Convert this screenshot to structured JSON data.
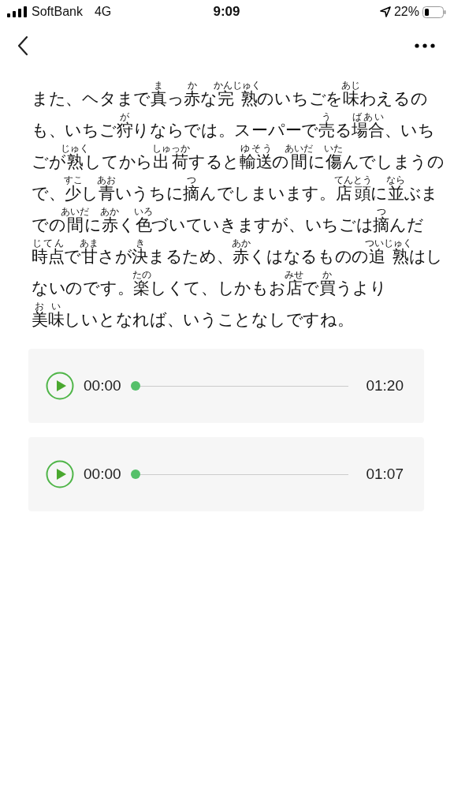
{
  "status_bar": {
    "carrier": "SoftBank",
    "network": "4G",
    "time": "9:09",
    "battery_percent": "22%"
  },
  "article": {
    "lines": [
      [
        {
          "text": "また、ヘタまで"
        },
        {
          "text": "真",
          "ruby": "ま"
        },
        {
          "text": "っ"
        },
        {
          "text": "赤",
          "ruby": "か"
        },
        {
          "text": "な"
        },
        {
          "text": "完熟",
          "ruby": "かんじゅく"
        },
        {
          "text": "のいちごを"
        },
        {
          "text": "味",
          "ruby": "あじ"
        },
        {
          "text": "わえるの"
        }
      ],
      [
        {
          "text": "も、いちご"
        },
        {
          "text": "狩",
          "ruby": "が"
        },
        {
          "text": "りならでは。スーパーで"
        },
        {
          "text": "売",
          "ruby": "う"
        },
        {
          "text": "る"
        },
        {
          "text": "場合",
          "ruby": "ばあい"
        },
        {
          "text": "、いち"
        }
      ],
      [
        {
          "text": "ごが"
        },
        {
          "text": "熟",
          "ruby": "じゅく"
        },
        {
          "text": "してから"
        },
        {
          "text": "出荷",
          "ruby": "しゅっか"
        },
        {
          "text": "すると"
        },
        {
          "text": "輸送",
          "ruby": "ゆそう"
        },
        {
          "text": "の"
        },
        {
          "text": "間",
          "ruby": "あいだ"
        },
        {
          "text": "に"
        },
        {
          "text": "傷",
          "ruby": "いた"
        },
        {
          "text": "んでしまうの"
        }
      ],
      [
        {
          "text": "で、"
        },
        {
          "text": "少",
          "ruby": "すこ"
        },
        {
          "text": "し"
        },
        {
          "text": "青",
          "ruby": "あお"
        },
        {
          "text": "いうちに"
        },
        {
          "text": "摘",
          "ruby": "つ"
        },
        {
          "text": "んでしまいます。"
        },
        {
          "text": "店頭",
          "ruby": "てんとう"
        },
        {
          "text": "に"
        },
        {
          "text": "並",
          "ruby": "なら"
        },
        {
          "text": "ぶま"
        }
      ],
      [
        {
          "text": "での"
        },
        {
          "text": "間",
          "ruby": "あいだ"
        },
        {
          "text": "に"
        },
        {
          "text": "赤",
          "ruby": "あか"
        },
        {
          "text": "く"
        },
        {
          "text": "色",
          "ruby": "いろ"
        },
        {
          "text": "づいていきますが、いちごは"
        },
        {
          "text": "摘",
          "ruby": "つ"
        },
        {
          "text": "んだ"
        }
      ],
      [
        {
          "text": "時点",
          "ruby": "じてん"
        },
        {
          "text": "で"
        },
        {
          "text": "甘",
          "ruby": "あま"
        },
        {
          "text": "さが"
        },
        {
          "text": "決",
          "ruby": "き"
        },
        {
          "text": "まるため、"
        },
        {
          "text": "赤",
          "ruby": "あか"
        },
        {
          "text": "くはなるものの"
        },
        {
          "text": "追熟",
          "ruby": "ついじゅく"
        },
        {
          "text": "はし"
        }
      ],
      [
        {
          "text": "ないのです。"
        },
        {
          "text": "楽",
          "ruby": "たの"
        },
        {
          "text": "しくて、しかもお"
        },
        {
          "text": "店",
          "ruby": "みせ"
        },
        {
          "text": "で"
        },
        {
          "text": "買",
          "ruby": "か"
        },
        {
          "text": "うより"
        }
      ],
      [
        {
          "text": "美味",
          "ruby": "おい"
        },
        {
          "text": "しいとなれば、いうことなしですね。"
        }
      ]
    ]
  },
  "audio_players": [
    {
      "current_time": "00:00",
      "level": 0,
      "duration": "01:20"
    },
    {
      "current_time": "00:00",
      "level": 0,
      "duration": "01:07"
    }
  ]
}
